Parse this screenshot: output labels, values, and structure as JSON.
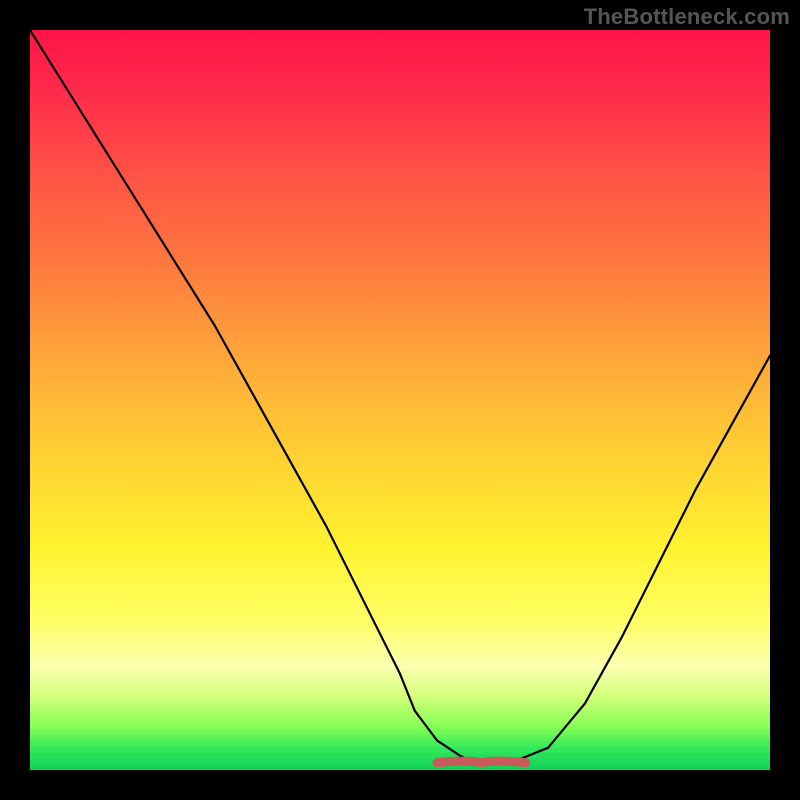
{
  "watermark": "TheBottleneck.com",
  "chart_data": {
    "type": "line",
    "title": "",
    "xlabel": "",
    "ylabel": "",
    "xlim": [
      0,
      100
    ],
    "ylim": [
      0,
      100
    ],
    "grid": false,
    "legend": false,
    "x": [
      0,
      5,
      10,
      15,
      20,
      25,
      30,
      35,
      40,
      45,
      50,
      52,
      55,
      58,
      60,
      62,
      65,
      70,
      75,
      80,
      85,
      90,
      95,
      100
    ],
    "values": [
      100,
      92,
      84,
      76,
      68,
      60,
      51,
      42,
      33,
      23,
      13,
      8,
      4,
      2,
      1,
      1,
      1,
      3,
      9,
      18,
      28,
      38,
      47,
      56
    ],
    "flat_region": {
      "x_start": 55,
      "x_end": 67,
      "y": 1,
      "stroke": "#c85a5a",
      "stroke_width": 9
    },
    "background": {
      "type": "vertical_gradient",
      "stops": [
        {
          "pos": 0.0,
          "color": "#ff1448"
        },
        {
          "pos": 0.18,
          "color": "#ff4d46"
        },
        {
          "pos": 0.45,
          "color": "#ffa939"
        },
        {
          "pos": 0.7,
          "color": "#fff22f"
        },
        {
          "pos": 0.86,
          "color": "#fcffb0"
        },
        {
          "pos": 0.94,
          "color": "#8aff55"
        },
        {
          "pos": 1.0,
          "color": "#0fcf58"
        }
      ]
    }
  }
}
